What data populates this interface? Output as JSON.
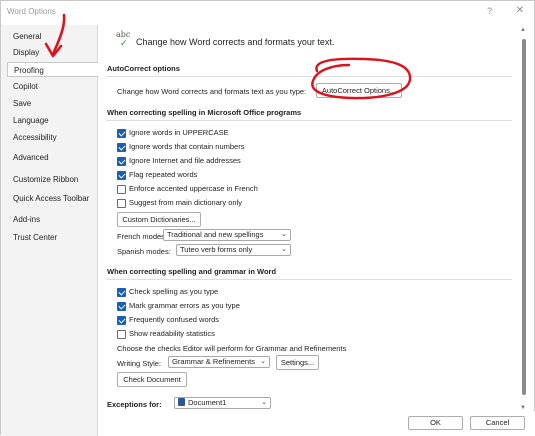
{
  "window": {
    "title": "Word Options",
    "help": "?",
    "close": "✕"
  },
  "sidebar": {
    "items": [
      {
        "label": "General"
      },
      {
        "label": "Display"
      },
      {
        "label": "Proofing"
      },
      {
        "label": "Copilot"
      },
      {
        "label": "Save"
      },
      {
        "label": "Language"
      },
      {
        "label": "Accessibility"
      },
      {
        "label": "Advanced"
      },
      {
        "label": "Customize Ribbon"
      },
      {
        "label": "Quick Access Toolbar"
      },
      {
        "label": "Add-ins"
      },
      {
        "label": "Trust Center"
      }
    ]
  },
  "header": {
    "icon_text": "abc",
    "check_glyph": "✓",
    "text": "Change how Word corrects and formats your text."
  },
  "autocorrect": {
    "section_title": "AutoCorrect options",
    "description": "Change how Word corrects and formats text as you type:",
    "button": "AutoCorrect Options..."
  },
  "office_spelling": {
    "section_title": "When correcting spelling in Microsoft Office programs",
    "options": [
      {
        "label": "Ignore words in UPPERCASE",
        "checked": true
      },
      {
        "label": "Ignore words that contain numbers",
        "checked": true
      },
      {
        "label": "Ignore Internet and file addresses",
        "checked": true
      },
      {
        "label": "Flag repeated words",
        "checked": true
      },
      {
        "label": "Enforce accented uppercase in French",
        "checked": false
      },
      {
        "label": "Suggest from main dictionary only",
        "checked": false
      }
    ],
    "custom_dict_button": "Custom Dictionaries...",
    "french_label": "French modes:",
    "french_value": "Traditional and new spellings",
    "spanish_label": "Spanish modes:",
    "spanish_value": "Tuteo verb forms only"
  },
  "word_spelling": {
    "section_title": "When correcting spelling and grammar in Word",
    "options": [
      {
        "label": "Check spelling as you type",
        "checked": true
      },
      {
        "label": "Mark grammar errors as you type",
        "checked": true
      },
      {
        "label": "Frequently confused words",
        "checked": true
      },
      {
        "label": "Show readability statistics",
        "checked": false
      }
    ],
    "editor_text": "Choose the checks Editor will perform for Grammar and Refinements",
    "writing_style_label": "Writing Style:",
    "writing_style_value": "Grammar & Refinements",
    "settings_button": "Settings...",
    "check_doc_button": "Check Document"
  },
  "exceptions": {
    "label": "Exceptions for:",
    "document": "Document1"
  },
  "footer": {
    "ok": "OK",
    "cancel": "Cancel"
  },
  "scroll": {
    "up": "▲",
    "down": "▼"
  },
  "colors": {
    "accent": "#1a5fb4",
    "annotation": "#d9141e"
  }
}
